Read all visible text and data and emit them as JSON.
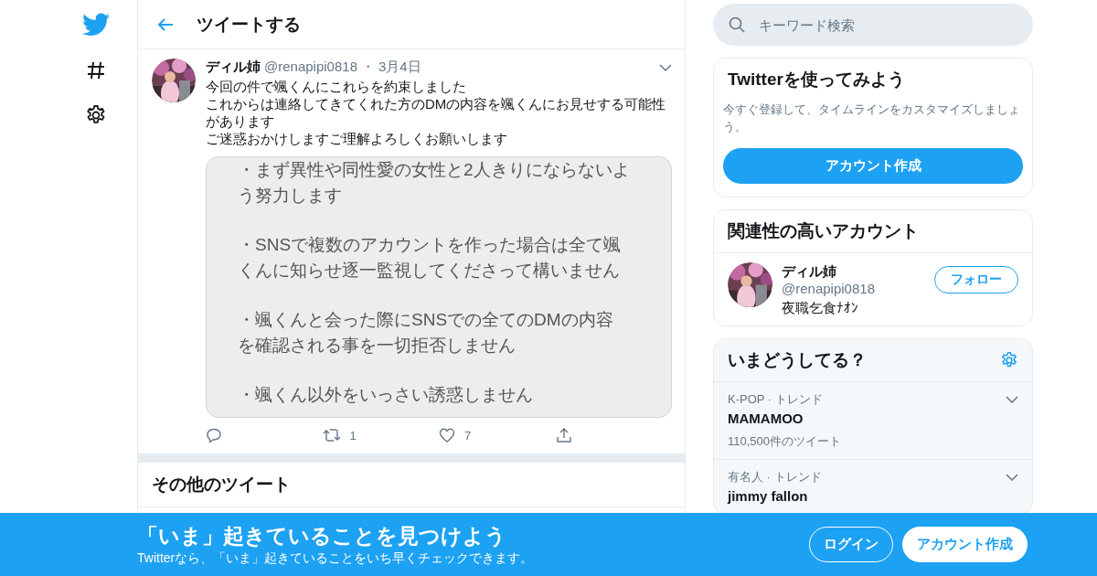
{
  "header": {
    "title": "ツイートする"
  },
  "tweet": {
    "name": "ディル姉",
    "handle": "@renapipi0818",
    "separator": "・",
    "date": "3月4日",
    "text": [
      "今回の件で颯くんにこれらを約束しました",
      "これからは連絡してきてくれた方のDMの内容を颯くんにお見せする可能性があります",
      "ご迷惑おかけしますご理解よろしくお願いします"
    ],
    "memo": [
      [
        "・まず異性や同性愛の女性と2人きりにならないよ",
        "う努力します"
      ],
      [
        "・SNSで複数のアカウントを作った場合は全て颯",
        "くんに知らせ逐一監視してくださって構いません"
      ],
      [
        "・颯くんと会った際にSNSでの全てのDMの内容",
        "を確認される事を一切拒否しません"
      ],
      [
        "・颯くん以外をいっさい誘惑しません"
      ]
    ],
    "actions": [
      {
        "kind": "reply"
      },
      {
        "kind": "retweet",
        "count": "1"
      },
      {
        "kind": "like",
        "count": "7"
      },
      {
        "kind": "share"
      }
    ]
  },
  "more": {
    "title": "その他のツイート"
  },
  "search": {
    "placeholder": "キーワード検索"
  },
  "signup": {
    "title": "Twitterを使ってみよう",
    "text": "今すぐ登録して、タイムラインをカスタマイズしましょう。",
    "button": "アカウント作成"
  },
  "related": {
    "title": "関連性の高いアカウント",
    "accounts": [
      {
        "name": "ディル姉",
        "handle": "@renapipi0818",
        "bio": "夜職乞食ﾅｵﾝ",
        "button": "フォロー"
      }
    ]
  },
  "trends": {
    "title": "いまどうしてる？",
    "items": [
      {
        "category": "K-POP · トレンド",
        "name": "MAMAMOO",
        "count": "110,500件のツイート"
      },
      {
        "category": "有名人 · トレンド",
        "name": "jimmy fallon"
      }
    ]
  },
  "banner": {
    "title": "「いま」起きていることを見つけよう",
    "subtitle": "Twitterなら、「いま」起きていることをいち早くチェックできます。",
    "login": "ログイン",
    "signup": "アカウント作成"
  }
}
